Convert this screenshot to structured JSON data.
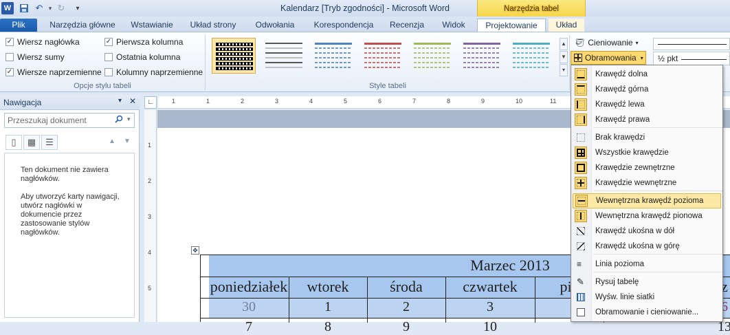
{
  "window": {
    "title": "Kalendarz [Tryb zgodności] - Microsoft Word",
    "contextual_tab_group": "Narzędzia tabel",
    "qat_icons": [
      "word-app-icon",
      "save-icon",
      "undo-icon",
      "redo-icon",
      "customize-qat-icon"
    ]
  },
  "tabs": {
    "file": "Plik",
    "home": "Narzędzia główne",
    "insert": "Wstawianie",
    "layout_page": "Układ strony",
    "references": "Odwołania",
    "mailings": "Korespondencja",
    "review": "Recenzja",
    "view": "Widok",
    "design": "Projektowanie",
    "layout": "Układ"
  },
  "ribbon": {
    "style_options": {
      "group_label": "Opcje stylu tabeli",
      "items": [
        {
          "label": "Wiersz nagłówka",
          "checked": true
        },
        {
          "label": "Wiersz sumy",
          "checked": false
        },
        {
          "label": "Wiersze naprzemienne",
          "checked": true
        },
        {
          "label": "Pierwsza kolumna",
          "checked": true
        },
        {
          "label": "Ostatnia kolumna",
          "checked": false
        },
        {
          "label": "Kolumny naprzemienne",
          "checked": false
        }
      ]
    },
    "table_styles": {
      "group_label": "Style tabeli",
      "swatch_colors": [
        "#000000",
        "#555555",
        "#4f81bd",
        "#c0504d",
        "#9bbb59",
        "#8064a2",
        "#4bacc6"
      ]
    },
    "shading_label": "Cieniowanie",
    "borders_label": "Obramowania",
    "pen_weight": "½ pkt"
  },
  "nav": {
    "title": "Nawigacja",
    "search_placeholder": "Przeszukaj dokument",
    "msg1": "Ten dokument nie zawiera nagłówków.",
    "msg2": "Aby utworzyć karty nawigacji, utwórz nagłówki w dokumencie przez zastosowanie stylów nagłówków."
  },
  "ruler": {
    "h_numbers": [
      "1",
      "1",
      "2",
      "3",
      "4",
      "5",
      "6",
      "7",
      "8",
      "9",
      "10",
      "11"
    ],
    "v_numbers": [
      "1",
      "2",
      "3",
      "4",
      "5"
    ]
  },
  "calendar": {
    "title": "Marzec 2013",
    "days": [
      "poniedziałek",
      "wtorek",
      "środa",
      "czwartek",
      "pią",
      "z"
    ],
    "row1": [
      "30",
      "1",
      "2",
      "3",
      "",
      "6"
    ],
    "row2": [
      "7",
      "8",
      "9",
      "10",
      "",
      "13"
    ]
  },
  "borders_menu": {
    "items": [
      {
        "label": "Krawędź dolna",
        "icon": "border-bottom-icon"
      },
      {
        "label": "Krawędź górna",
        "icon": "border-top-icon"
      },
      {
        "label": "Krawędź lewa",
        "icon": "border-left-icon"
      },
      {
        "label": "Krawędź prawa",
        "icon": "border-right-icon"
      },
      {
        "label": "Brak krawędzi",
        "icon": "no-border-icon"
      },
      {
        "label": "Wszystkie krawędzie",
        "icon": "all-borders-icon"
      },
      {
        "label": "Krawędzie zewnętrzne",
        "icon": "outside-borders-icon"
      },
      {
        "label": "Krawędzie wewnętrzne",
        "icon": "inside-borders-icon"
      },
      {
        "label": "Wewnętrzna krawędź pozioma",
        "icon": "inside-horizontal-border-icon"
      },
      {
        "label": "Wewnętrzna krawędź pionowa",
        "icon": "inside-vertical-border-icon"
      },
      {
        "label": "Krawędź ukośna w dół",
        "icon": "diagonal-down-border-icon"
      },
      {
        "label": "Krawędź ukośna w górę",
        "icon": "diagonal-up-border-icon"
      },
      {
        "label": "Linia pozioma",
        "icon": "horizontal-line-icon"
      },
      {
        "label": "Rysuj tabelę",
        "icon": "draw-table-icon"
      },
      {
        "label": "Wyśw. linie siatki",
        "icon": "view-gridlines-icon"
      },
      {
        "label": "Obramowanie i cieniowanie...",
        "icon": "borders-shading-dialog-icon"
      }
    ],
    "highlighted": "Wewnętrzna krawędź pozioma"
  }
}
